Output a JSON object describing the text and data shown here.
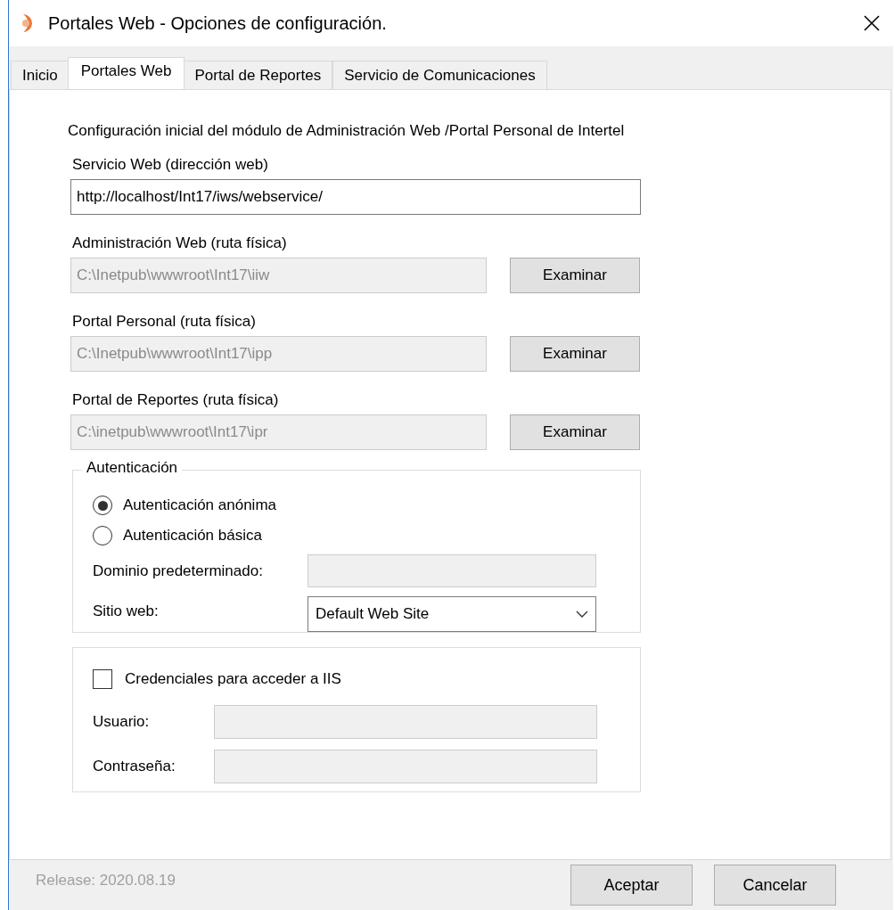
{
  "window": {
    "title": "Portales Web - Opciones de configuración."
  },
  "tabs": [
    {
      "label": "Inicio",
      "selected": false
    },
    {
      "label": "Portales Web",
      "selected": true
    },
    {
      "label": "Portal de Reportes",
      "selected": false
    },
    {
      "label": "Servicio de Comunicaciones",
      "selected": false
    }
  ],
  "panel": {
    "intro": "Configuración inicial del módulo de Administración Web /Portal Personal de Intertel",
    "fields": [
      {
        "label": "Servicio Web (dirección web)",
        "value": "http://localhost/Int17/iws/webservice/",
        "disabled": false
      },
      {
        "label": "Administración Web (ruta física)",
        "value": "C:\\Inetpub\\wwwroot\\Int17\\iiw",
        "disabled": true,
        "button": "Examinar"
      },
      {
        "label": "Portal Personal (ruta física)",
        "value": "C:\\Inetpub\\wwwroot\\Int17\\ipp",
        "disabled": true,
        "button": "Examinar"
      },
      {
        "label": "Portal de Reportes (ruta física)",
        "value": "C:\\inetpub\\wwwroot\\Int17\\ipr",
        "disabled": true,
        "button": "Examinar"
      }
    ],
    "authentication": {
      "legend": "Autenticación",
      "options": [
        {
          "label": "Autenticación anónima",
          "selected": true
        },
        {
          "label": "Autenticación básica",
          "selected": false
        }
      ],
      "domain": {
        "label": "Dominio predeterminado:",
        "disabled": true
      },
      "site": {
        "label": "Sitio web:",
        "value": "Default Web Site"
      }
    },
    "credentials": {
      "label": "Credenciales para acceder a IIS",
      "checked": false,
      "fields": [
        {
          "label": "Usuario:",
          "disabled": true
        },
        {
          "label": "Contraseña:",
          "disabled": true
        }
      ]
    }
  },
  "footer": {
    "release": "Release: 2020.08.19",
    "buttons": [
      "Aceptar",
      "Cancelar"
    ]
  }
}
